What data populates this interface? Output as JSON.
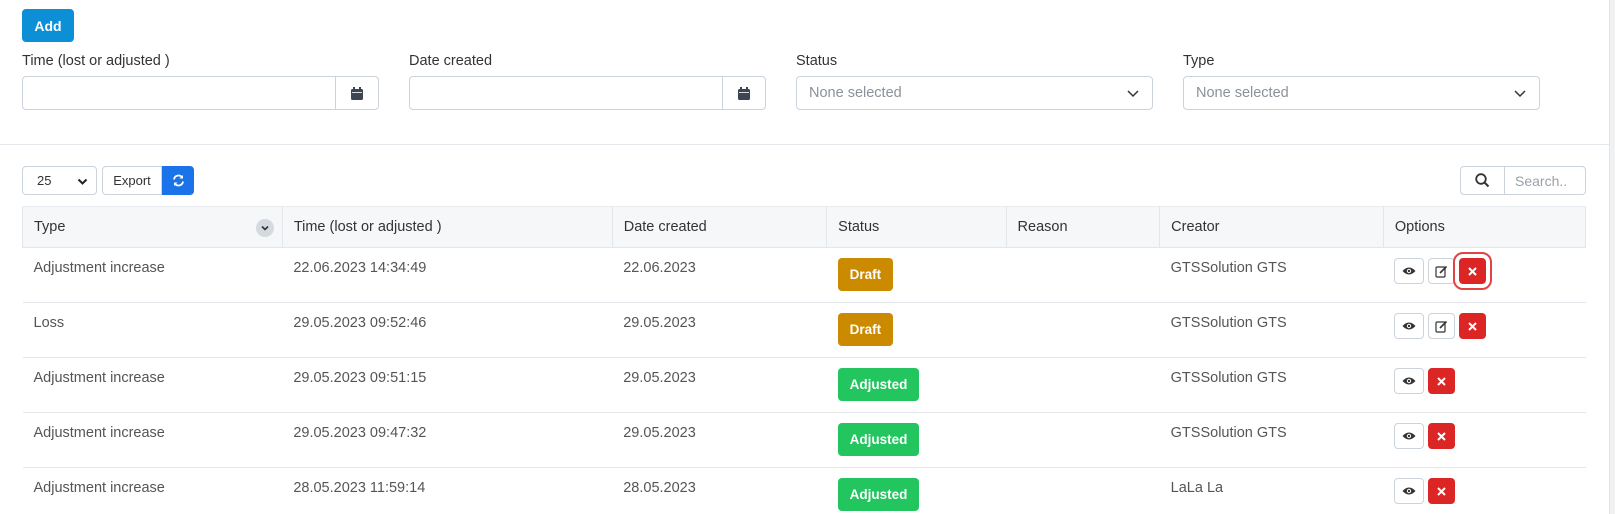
{
  "toolbar": {
    "add_label": "Add"
  },
  "filters": {
    "time": {
      "label": "Time (lost or adjusted )",
      "value": ""
    },
    "date_created": {
      "label": "Date created",
      "value": ""
    },
    "status": {
      "label": "Status",
      "placeholder": "None selected"
    },
    "type": {
      "label": "Type",
      "placeholder": "None selected"
    }
  },
  "table_controls": {
    "page_length": "25",
    "export_label": "Export",
    "search_placeholder": "Search.."
  },
  "table": {
    "headers": [
      "Type",
      "Time (lost or adjusted )",
      "Date created",
      "Status",
      "Reason",
      "Creator",
      "Options"
    ],
    "rows": [
      {
        "type": "Adjustment increase",
        "time": "22.06.2023 14:34:49",
        "date": "22.06.2023",
        "status": "Draft",
        "reason": "",
        "creator": "GTSSolution GTS"
      },
      {
        "type": "Loss",
        "time": "29.05.2023 09:52:46",
        "date": "29.05.2023",
        "status": "Draft",
        "reason": "",
        "creator": "GTSSolution GTS"
      },
      {
        "type": "Adjustment increase",
        "time": "29.05.2023 09:51:15",
        "date": "29.05.2023",
        "status": "Adjusted",
        "reason": "",
        "creator": "GTSSolution GTS"
      },
      {
        "type": "Adjustment increase",
        "time": "29.05.2023 09:47:32",
        "date": "29.05.2023",
        "status": "Adjusted",
        "reason": "",
        "creator": "GTSSolution GTS"
      },
      {
        "type": "Adjustment increase",
        "time": "28.05.2023 11:59:14",
        "date": "28.05.2023",
        "status": "Adjusted",
        "reason": "",
        "creator": "LaLa La"
      }
    ]
  },
  "colors": {
    "primary": "#0d8fd8",
    "draft": "#cc8a00",
    "adjusted": "#22c55e",
    "danger": "#dc2626"
  }
}
